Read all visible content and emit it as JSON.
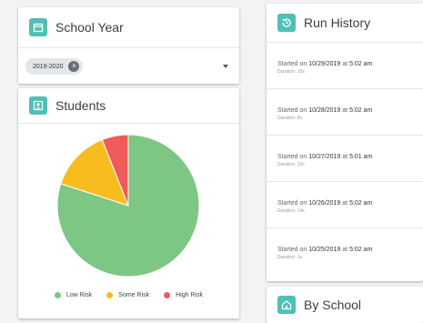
{
  "school_year": {
    "title": "School Year",
    "icon": "calendar-icon",
    "selected_chip": "2019-2020"
  },
  "students": {
    "title": "Students",
    "icon": "student-icon"
  },
  "chart_data": {
    "type": "pie",
    "categories": [
      "Low Risk",
      "Some Risk",
      "High Risk"
    ],
    "values": [
      80,
      14,
      6
    ],
    "colors": [
      "#7dc683",
      "#f7bd1f",
      "#ee5b5b"
    ],
    "legend": "bottom"
  },
  "run_history": {
    "title": "Run History",
    "icon": "history-icon",
    "prefix": "Started on",
    "connector": "at",
    "runs": [
      {
        "date": "10/29/2019",
        "time": "5:02 am",
        "duration": "Duration: 10s"
      },
      {
        "date": "10/28/2019",
        "time": "5:02 am",
        "duration": "Duration: 8s"
      },
      {
        "date": "10/27/2019",
        "time": "5:01 am",
        "duration": "Duration: 10s"
      },
      {
        "date": "10/26/2019",
        "time": "5:02 am",
        "duration": "Duration: 14s"
      },
      {
        "date": "10/25/2019",
        "time": "5:02 am",
        "duration": "Duration: 1s"
      }
    ]
  },
  "by_school": {
    "title": "By School",
    "icon": "school-icon"
  },
  "colors": {
    "accent": "#4fc0b6",
    "low_risk": "#7dc683",
    "some_risk": "#f7bd1f",
    "high_risk": "#ee5b5b"
  }
}
